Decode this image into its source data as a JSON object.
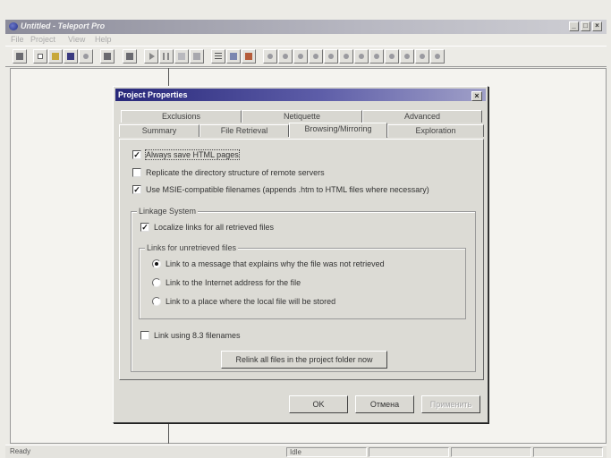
{
  "window": {
    "title": "Untitled - Teleport Pro",
    "min": "_",
    "max": "□",
    "close": "×"
  },
  "menu": [
    "File",
    "Project",
    "View",
    "Help"
  ],
  "toolbar_icons": [
    "properties-icon",
    "new-icon",
    "open-icon",
    "save-icon",
    "wizard-icon",
    "start-icon",
    "pause-icon",
    "stop-icon",
    "list-icon",
    "grid-icon",
    "tree-icon",
    "bookmark-icon"
  ],
  "dialog": {
    "title": "Project Properties",
    "close": "×",
    "tabs_back": [
      "Exclusions",
      "Netiquette",
      "Advanced"
    ],
    "tabs_front": [
      "Summary",
      "File Retrieval",
      "Browsing/Mirroring",
      "Exploration"
    ],
    "active_tab": "Browsing/Mirroring",
    "options": {
      "save_html": {
        "label": "Always save HTML pages",
        "checked": true
      },
      "replicate_dirs": {
        "label": "Replicate the directory structure of remote servers",
        "checked": false
      },
      "msie_names": {
        "label": "Use MSIE-compatible filenames (appends .htm to HTML files where necessary)",
        "checked": true
      }
    },
    "linkage": {
      "legend": "Linkage System",
      "localize": {
        "label": "Localize links for all retrieved files",
        "checked": true
      },
      "unretrieved_legend": "Links for unretrieved files",
      "radios": [
        {
          "label": "Link to a message that explains why the file was not retrieved",
          "selected": true
        },
        {
          "label": "Link to the Internet address for the file",
          "selected": false
        },
        {
          "label": "Link to a place where the local file will be stored",
          "selected": false
        }
      ],
      "link_83": {
        "label": "Link using 8.3 filenames",
        "checked": false
      },
      "relink_button": "Relink all files in the project folder now"
    },
    "buttons": {
      "ok": "OK",
      "cancel": "Отмена",
      "apply": "Применить"
    }
  },
  "status": {
    "ready": "Ready",
    "idle": "Idle"
  }
}
